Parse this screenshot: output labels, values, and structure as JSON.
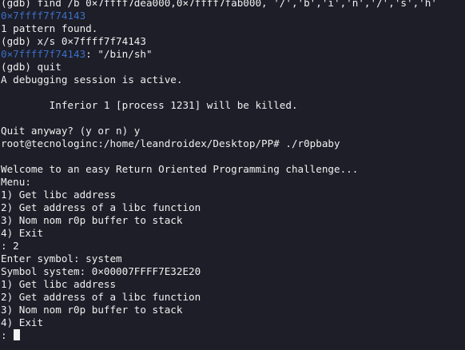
{
  "terminal": {
    "lines": [
      {
        "text": "(gdb) find /b 0×7ffff7dea000,0×7ffff7fab000, '/','b','i','n','/','s','h'"
      },
      {
        "addr": "0×7ffff7f74143"
      },
      {
        "text": "1 pattern found."
      },
      {
        "text": "(gdb) x/s 0×7ffff7f74143"
      },
      {
        "addr": "0×7ffff7f74143",
        "text": ": \"/bin/sh\""
      },
      {
        "text": "(gdb) quit"
      },
      {
        "text": "A debugging session is active."
      },
      {
        "text": ""
      },
      {
        "text": "        Inferior 1 [process 1231] will be killed."
      },
      {
        "text": ""
      },
      {
        "text": "Quit anyway? (y or n) y"
      },
      {
        "text": "root@tecnologinc:/home/leandroidex/Desktop/PP# ./r0pbaby"
      },
      {
        "text": ""
      },
      {
        "text": "Welcome to an easy Return Oriented Programming challenge..."
      },
      {
        "text": "Menu:"
      },
      {
        "text": "1) Get libc address"
      },
      {
        "text": "2) Get address of a libc function"
      },
      {
        "text": "3) Nom nom r0p buffer to stack"
      },
      {
        "text": "4) Exit"
      },
      {
        "text": ": 2"
      },
      {
        "text": "Enter symbol: system"
      },
      {
        "text": "Symbol system: 0×00007FFFF7E32E20"
      },
      {
        "text": "1) Get libc address"
      },
      {
        "text": "2) Get address of a libc function"
      },
      {
        "text": "3) Nom nom r0p buffer to stack"
      },
      {
        "text": "4) Exit"
      },
      {
        "text": ":",
        "cursor": true
      }
    ]
  },
  "colors": {
    "background": "#1d1e28",
    "text": "#f0f0f0",
    "address": "#3d6ec6",
    "cursor": "#f2f2f2"
  }
}
